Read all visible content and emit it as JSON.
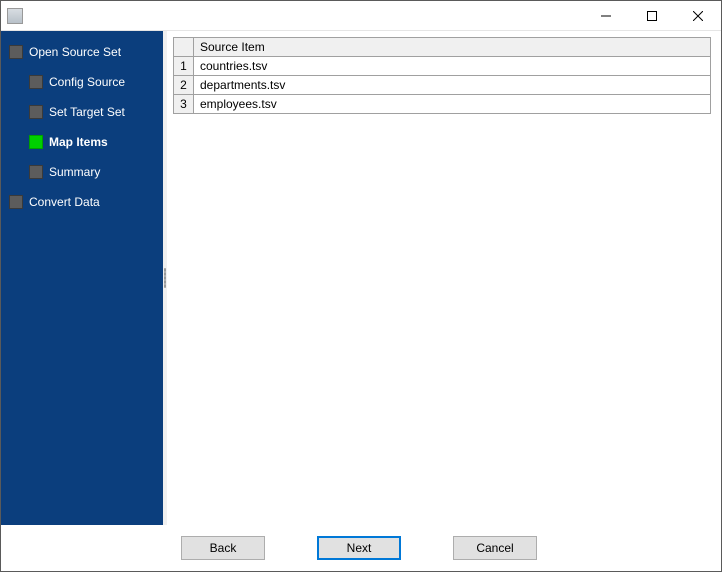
{
  "sidebar": {
    "items": [
      {
        "label": "Open Source Set",
        "level": 1,
        "active": false
      },
      {
        "label": "Config Source",
        "level": 2,
        "active": false
      },
      {
        "label": "Set Target Set",
        "level": 2,
        "active": false
      },
      {
        "label": "Map Items",
        "level": 2,
        "active": true
      },
      {
        "label": "Summary",
        "level": 2,
        "active": false
      },
      {
        "label": "Convert Data",
        "level": 1,
        "active": false
      }
    ]
  },
  "table": {
    "header": "Source Item",
    "rows": [
      {
        "num": "1",
        "value": "countries.tsv"
      },
      {
        "num": "2",
        "value": "departments.tsv"
      },
      {
        "num": "3",
        "value": "employees.tsv"
      }
    ]
  },
  "buttons": {
    "back": "Back",
    "next": "Next",
    "cancel": "Cancel"
  }
}
